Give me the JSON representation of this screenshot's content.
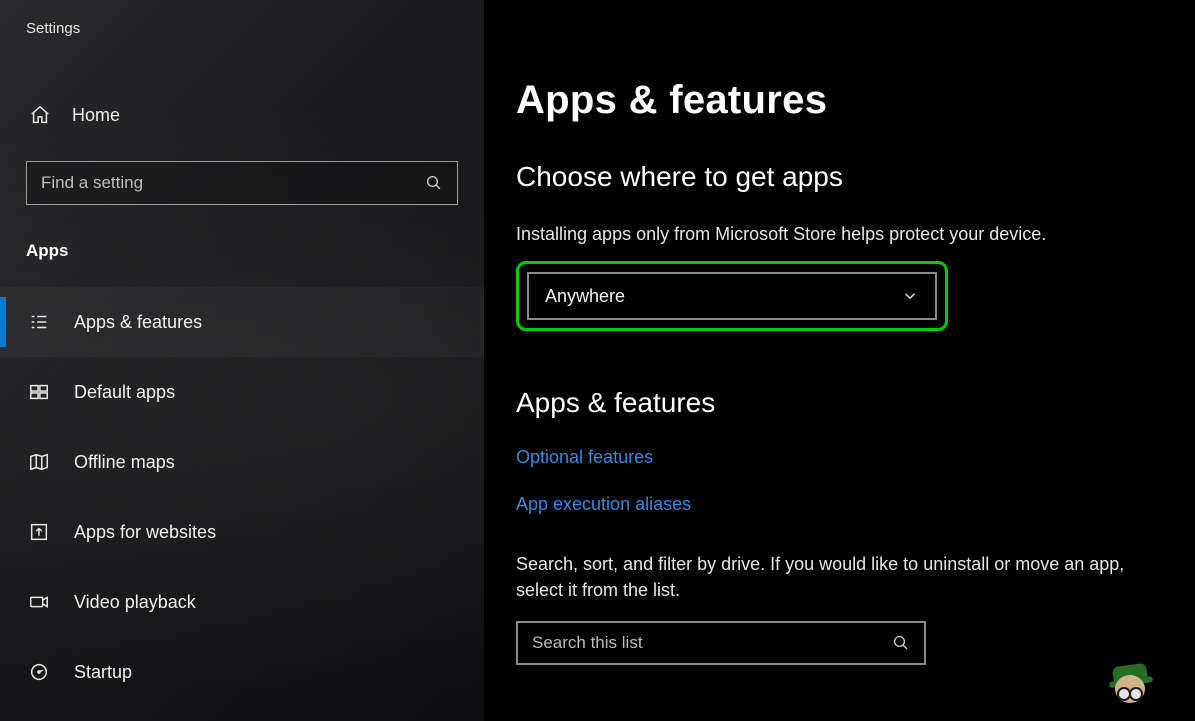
{
  "window_title": "Settings",
  "sidebar": {
    "home_label": "Home",
    "search_placeholder": "Find a setting",
    "section_label": "Apps",
    "items": [
      {
        "id": "apps-features",
        "label": "Apps & features",
        "icon": "list-icon",
        "active": true
      },
      {
        "id": "default-apps",
        "label": "Default apps",
        "icon": "defaults-icon",
        "active": false
      },
      {
        "id": "offline-maps",
        "label": "Offline maps",
        "icon": "map-icon",
        "active": false
      },
      {
        "id": "apps-for-websites",
        "label": "Apps for websites",
        "icon": "open-ext-icon",
        "active": false
      },
      {
        "id": "video-playback",
        "label": "Video playback",
        "icon": "video-icon",
        "active": false
      },
      {
        "id": "startup",
        "label": "Startup",
        "icon": "startup-icon",
        "active": false
      }
    ]
  },
  "main": {
    "page_title": "Apps & features",
    "choose_heading": "Choose where to get apps",
    "choose_desc": "Installing apps only from Microsoft Store helps protect your device.",
    "source_dropdown_value": "Anywhere",
    "af_heading": "Apps & features",
    "link_optional": "Optional features",
    "link_aliases": "App execution aliases",
    "af_desc": "Search, sort, and filter by drive. If you would like to uninstall or move an app, select it from the list.",
    "list_search_placeholder": "Search this list"
  }
}
